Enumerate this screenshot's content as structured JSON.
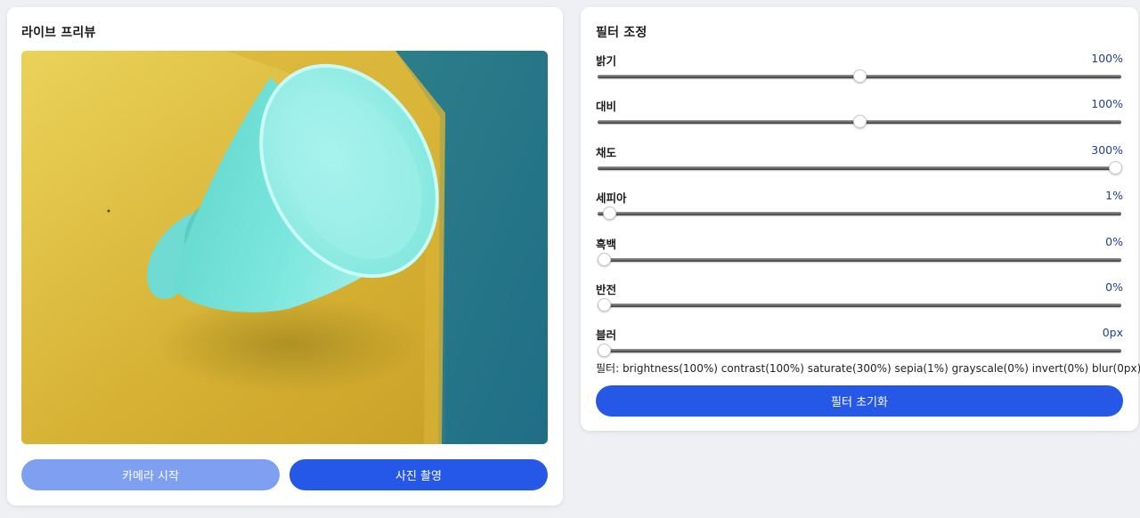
{
  "preview": {
    "title": "라이브 프리뷰",
    "start_button": "카메라 시작",
    "capture_button": "사진 촬영"
  },
  "filters": {
    "title": "필터 조정",
    "sliders": [
      {
        "label": "밝기",
        "value_text": "100%",
        "value": 100,
        "min": 0,
        "max": 200
      },
      {
        "label": "대비",
        "value_text": "100%",
        "value": 100,
        "min": 0,
        "max": 200
      },
      {
        "label": "채도",
        "value_text": "300%",
        "value": 300,
        "min": 0,
        "max": 300
      },
      {
        "label": "세피아",
        "value_text": "1%",
        "value": 1,
        "min": 0,
        "max": 100
      },
      {
        "label": "흑백",
        "value_text": "0%",
        "value": 0,
        "min": 0,
        "max": 100
      },
      {
        "label": "반전",
        "value_text": "0%",
        "value": 0,
        "min": 0,
        "max": 100
      },
      {
        "label": "블러",
        "value_text": "0px",
        "value": 0,
        "min": 0,
        "max": 10
      }
    ],
    "filter_string": "필터: brightness(100%) contrast(100%) saturate(300%) sepia(1%) grayscale(0%) invert(0%) blur(0px)",
    "reset_button": "필터 초기화"
  },
  "colors": {
    "primary": "#2558e6",
    "primary_disabled": "#7f9ff0",
    "value_text": "#1f3f91"
  }
}
